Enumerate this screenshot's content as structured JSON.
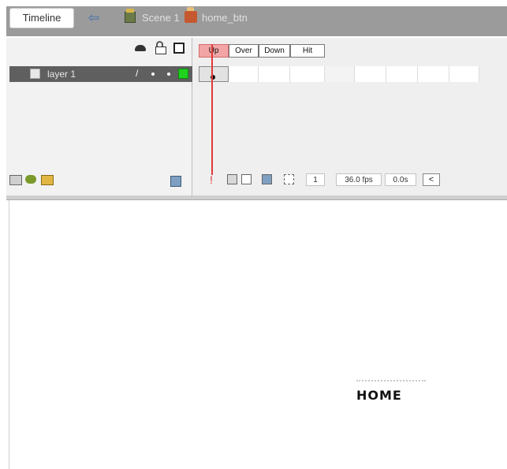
{
  "header": {
    "timeline_tab": "Timeline",
    "back_icon": "back-arrow-icon",
    "scene_label": "Scene 1",
    "symbol_label": "home_btn"
  },
  "layers": {
    "header_icons": [
      "eye-icon",
      "lock-icon",
      "outline-icon"
    ],
    "items": [
      {
        "name": "layer 1",
        "outline_color": "#1fd31f"
      }
    ]
  },
  "frames": {
    "labels": [
      "Up",
      "Over",
      "Down",
      "Hit"
    ],
    "active": "Up",
    "current_frame": "1",
    "fps": "36.0 fps",
    "time": "0.0s",
    "scroll_left": "<"
  },
  "stage": {
    "button_text": "HOME"
  },
  "colors": {
    "playhead": "#e03a3a",
    "active_frame_bg": "#f2a5a5",
    "layer_selected_bg": "#5f5f5f"
  }
}
